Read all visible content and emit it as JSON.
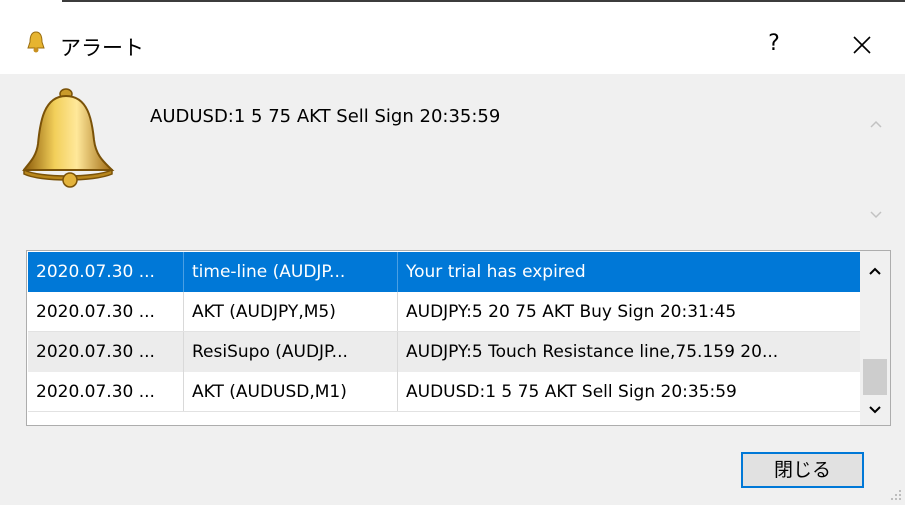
{
  "window": {
    "title": "アラート",
    "help_label": "?",
    "close_icon": "close-icon",
    "title_icon": "bell-icon"
  },
  "alert": {
    "icon": "bell-icon",
    "message": "AUDUSD:1 5 75 AKT Sell Sign 20:35:59"
  },
  "list": {
    "rows": [
      {
        "time": "2020.07.30 ...",
        "source": "time-line (AUDJP...",
        "message": "Your trial has expired",
        "selected": true
      },
      {
        "time": "2020.07.30 ...",
        "source": "AKT (AUDJPY,M5)",
        "message": "AUDJPY:5 20 75 AKT Buy Sign 20:31:45",
        "selected": false
      },
      {
        "time": "2020.07.30 ...",
        "source": "ResiSupo (AUDJP...",
        "message": "AUDJPY:5 Touch Resistance line,75.159 20...",
        "selected": false
      },
      {
        "time": "2020.07.30 ...",
        "source": "AKT (AUDUSD,M1)",
        "message": "AUDUSD:1 5 75 AKT Sell Sign 20:35:59",
        "selected": false
      }
    ]
  },
  "buttons": {
    "close_label": "閉じる"
  },
  "colors": {
    "selection": "#0078d7",
    "window_bg": "#f0f0f0"
  }
}
